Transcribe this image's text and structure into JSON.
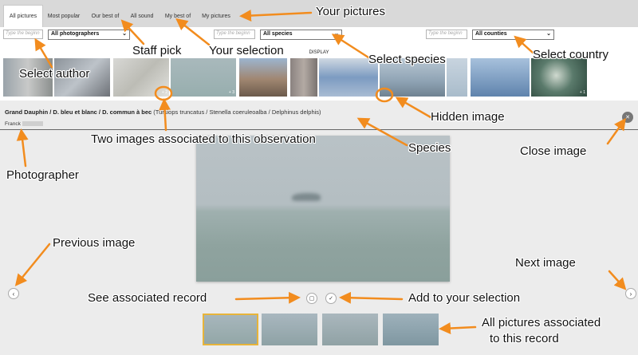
{
  "tabs": [
    {
      "label": "All pictures",
      "active": true
    },
    {
      "label": "Most popular",
      "active": false
    },
    {
      "label": "Our best of",
      "active": false
    },
    {
      "label": "All sound",
      "active": false
    },
    {
      "label": "My best of",
      "active": false
    },
    {
      "label": "My pictures",
      "active": false
    }
  ],
  "filters": {
    "author_search_placeholder": "Type the beginn",
    "photographers_select": "All photographers",
    "species_search_placeholder": "Type the beginn",
    "species_select": "All species",
    "country_search_placeholder": "Type the beginn",
    "country_select": "All counties",
    "display_button": "DISPLAY"
  },
  "thumbnails": {
    "badge_two": "+ 2",
    "badge_three": "+ 3",
    "badge_one": "+ 1"
  },
  "observation": {
    "names_bold": "Grand Dauphin / D. bleu et blanc / D. commun à bec",
    "names_latin": "(Tursiops truncatus / Stenella coeruleoalba / Delphinus delphis)",
    "photographer": "Franck"
  },
  "icons": {
    "close": "close-icon",
    "prev": "chevron-left-icon",
    "next": "chevron-right-icon",
    "record": "record-icon",
    "select": "check-icon",
    "dropdown": "chevron-down-icon"
  },
  "annotations": {
    "your_pictures": "Your pictures",
    "staff_pick": "Staff pick",
    "your_selection": "Your selection",
    "select_species": "Select species",
    "select_country": "Select country",
    "select_author": "Select author",
    "hidden_image": "Hidden image",
    "two_images": "Two images associated to this observation",
    "species": "Species",
    "close_image": "Close image",
    "photographer": "Photographer",
    "previous_image": "Previous image",
    "next_image": "Next image",
    "see_record": "See associated record",
    "add_selection": "Add to your selection",
    "all_pictures_line1": "All pictures associated",
    "all_pictures_line2": "to this record"
  },
  "colors": {
    "annotation_arrow": "#f28c1e",
    "tab_bar": "#d9d9d9",
    "viewer_bg": "#ececec",
    "selected_thumb_border": "#e7b43a"
  }
}
